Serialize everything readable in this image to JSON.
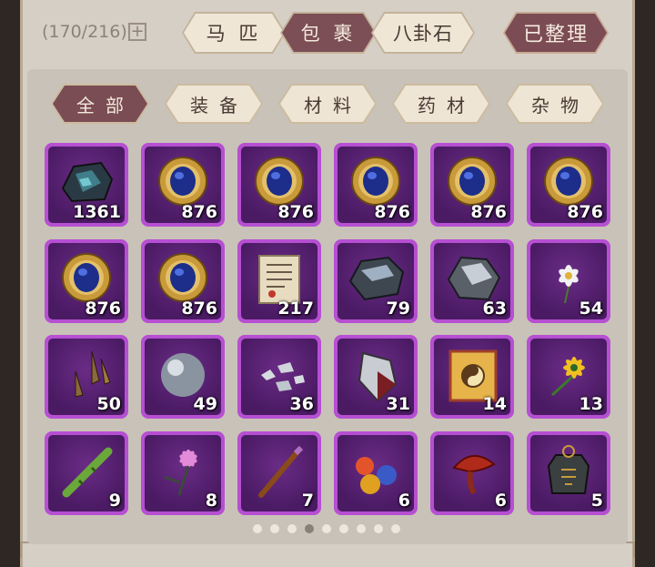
{
  "header": {
    "capacity": "(170/216)",
    "plus": "+",
    "tabs": [
      {
        "label": "马 匹",
        "active": false
      },
      {
        "label": "包 裹",
        "active": true
      },
      {
        "label": "八卦石",
        "active": false
      }
    ],
    "sorted_label": "已整理"
  },
  "filters": [
    {
      "label": "全部",
      "active": true
    },
    {
      "label": "装备",
      "active": false
    },
    {
      "label": "材料",
      "active": false
    },
    {
      "label": "药材",
      "active": false
    },
    {
      "label": "杂物",
      "active": false
    }
  ],
  "items": [
    {
      "icon": "dark-ore-icon",
      "count": "1361"
    },
    {
      "icon": "sapphire-medallion-icon",
      "count": "876"
    },
    {
      "icon": "sapphire-medallion-icon",
      "count": "876"
    },
    {
      "icon": "sapphire-medallion-icon",
      "count": "876"
    },
    {
      "icon": "sapphire-medallion-icon",
      "count": "876"
    },
    {
      "icon": "sapphire-medallion-icon",
      "count": "876"
    },
    {
      "icon": "sapphire-medallion-icon",
      "count": "876"
    },
    {
      "icon": "sapphire-medallion-icon",
      "count": "876"
    },
    {
      "icon": "scroll-letter-icon",
      "count": "217"
    },
    {
      "icon": "iron-ore-icon",
      "count": "79"
    },
    {
      "icon": "silver-ore-icon",
      "count": "63"
    },
    {
      "icon": "white-flower-icon",
      "count": "54"
    },
    {
      "icon": "claws-icon",
      "count": "50"
    },
    {
      "icon": "steel-ball-icon",
      "count": "49"
    },
    {
      "icon": "silver-shards-icon",
      "count": "36"
    },
    {
      "icon": "crystal-shard-icon",
      "count": "31"
    },
    {
      "icon": "taiji-talisman-icon",
      "count": "14"
    },
    {
      "icon": "yellow-flower-icon",
      "count": "13"
    },
    {
      "icon": "bamboo-icon",
      "count": "9"
    },
    {
      "icon": "orchid-icon",
      "count": "8"
    },
    {
      "icon": "wooden-spike-icon",
      "count": "7"
    },
    {
      "icon": "colored-orbs-icon",
      "count": "6"
    },
    {
      "icon": "lingzhi-mushroom-icon",
      "count": "6"
    },
    {
      "icon": "token-plaque-icon",
      "count": "5"
    }
  ],
  "pagination": {
    "total": 9,
    "active_index": 3
  }
}
